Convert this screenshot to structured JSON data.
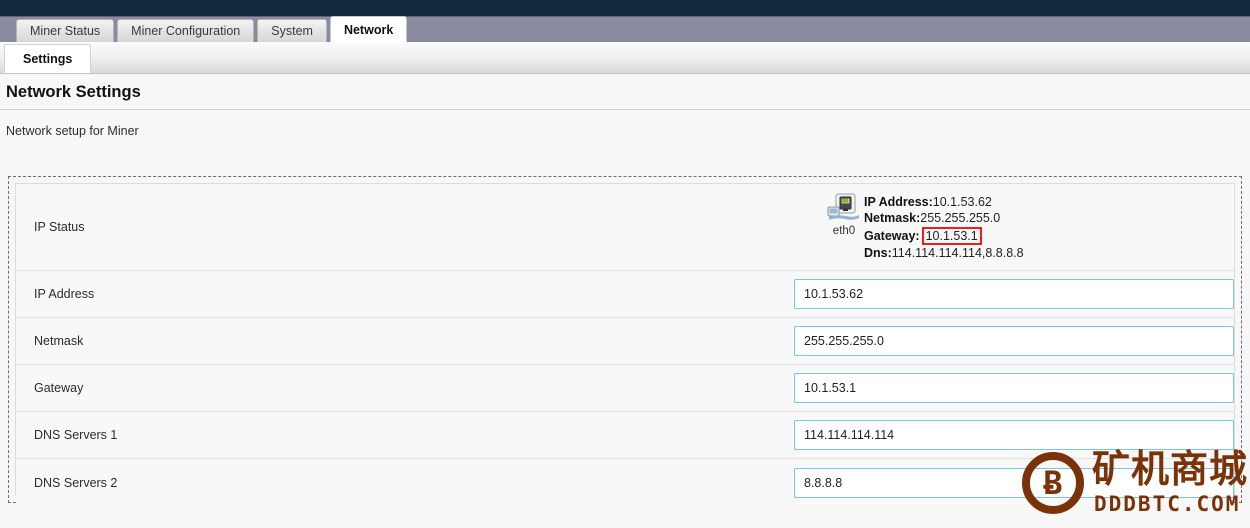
{
  "window": {
    "topbar_color": "#12293d",
    "tabstrip_color": "#8b8b9f"
  },
  "main_tabs": [
    {
      "label": "Miner Status",
      "active": false
    },
    {
      "label": "Miner Configuration",
      "active": false
    },
    {
      "label": "System",
      "active": false
    },
    {
      "label": "Network",
      "active": true
    }
  ],
  "sub_tabs": [
    {
      "label": "Settings",
      "active": true
    }
  ],
  "page": {
    "title": "Network Settings",
    "subtitle": "Network setup for Miner"
  },
  "ip_status": {
    "row_label": "IP Status",
    "interface_name": "eth0",
    "interface_icon": "ethernet-port-icon",
    "lines": [
      {
        "key": "IP Address:",
        "value": "10.1.53.62",
        "highlight": false
      },
      {
        "key": "Netmask:",
        "value": "255.255.255.0",
        "highlight": false
      },
      {
        "key": "Gateway:",
        "value": "10.1.53.1",
        "highlight": true
      },
      {
        "key": "Dns:",
        "value": "114.114.114.114,8.8.8.8",
        "highlight": false
      }
    ],
    "highlight_color": "#ee1c1c"
  },
  "fields": [
    {
      "label": "IP Address",
      "value": "10.1.53.62",
      "placeholder": ""
    },
    {
      "label": "Netmask",
      "value": "255.255.255.0",
      "placeholder": ""
    },
    {
      "label": "Gateway",
      "value": "10.1.53.1",
      "placeholder": ""
    },
    {
      "label": "DNS Servers 1",
      "value": "114.114.114.114",
      "placeholder": ""
    },
    {
      "label": "DNS Servers 2",
      "value": "8.8.8.8",
      "placeholder": ""
    }
  ],
  "watermark": {
    "coin_symbol": "Ƀ",
    "brand_cn": "矿机商城",
    "domain": "DDDBTC.COM",
    "color": "#7a3208"
  }
}
